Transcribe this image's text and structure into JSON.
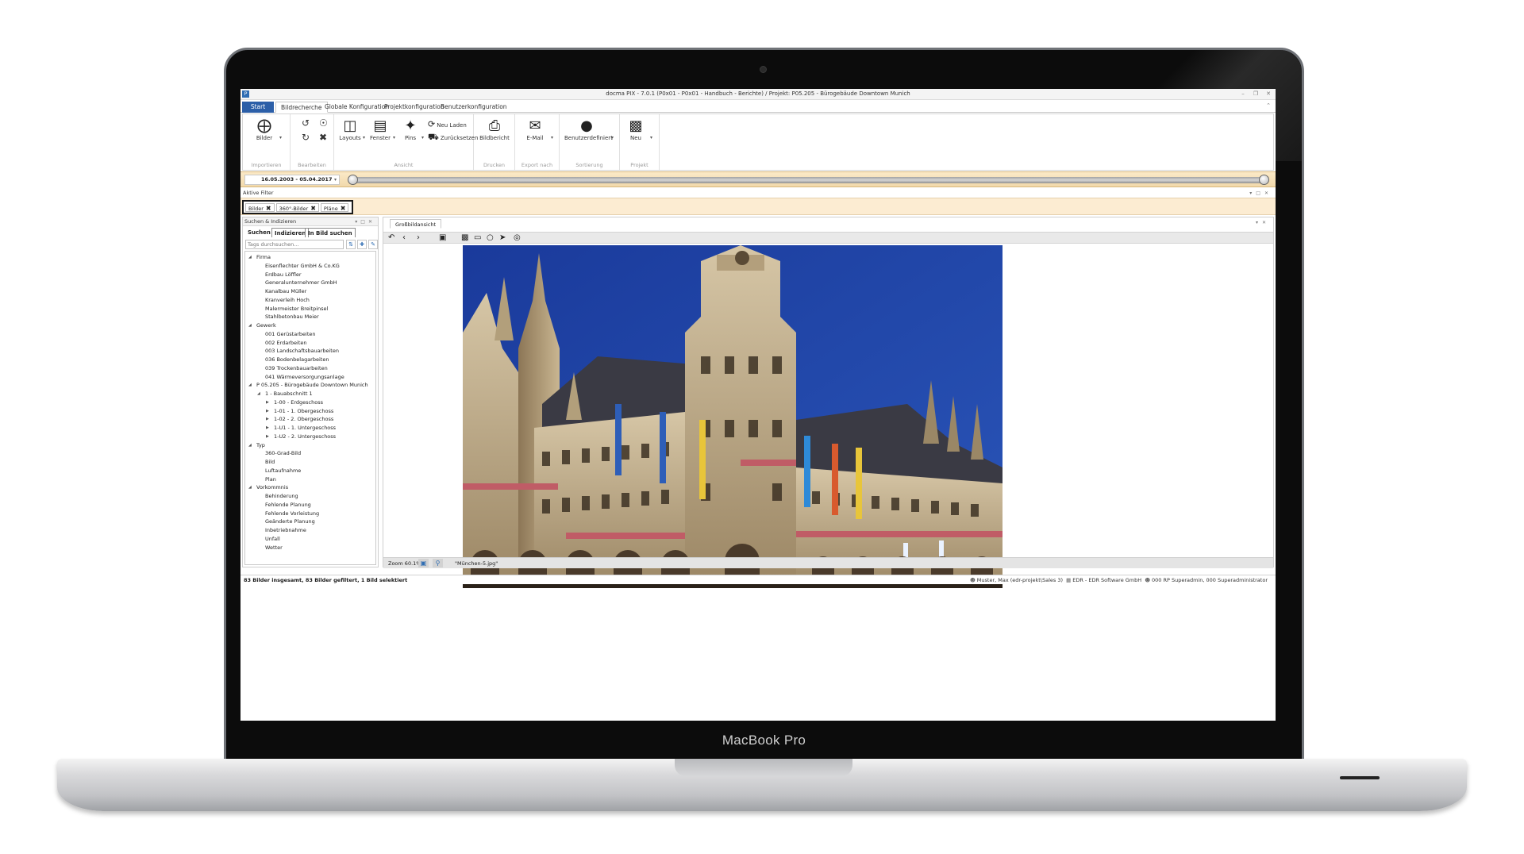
{
  "window": {
    "title": "docma PIX - 7.0.1 (P0x01 - P0x01 - Handbuch - Berichte) / Projekt: P05.205 - Bürogebäude Downtown Munich",
    "app_icon": "app-icon",
    "controls": [
      "minimize-icon",
      "restore-icon",
      "close-icon"
    ]
  },
  "tabs": [
    {
      "label": "Start"
    },
    {
      "label": "Bildrecherche"
    },
    {
      "label": "Globale Konfiguration"
    },
    {
      "label": "Projektkonfiguration"
    },
    {
      "label": "Benutzerkonfiguration"
    }
  ],
  "ribbon": {
    "groups": [
      {
        "label": "Importieren"
      },
      {
        "label": "Bearbeiten"
      },
      {
        "label": "Ansicht"
      },
      {
        "label": "Drucken"
      },
      {
        "label": "Export nach"
      },
      {
        "label": "Sortierung"
      },
      {
        "label": "Projekt"
      }
    ],
    "buttons": {
      "bilder": "Bilder",
      "layouts": "Layouts",
      "fenster": "Fenster",
      "pins": "Pins",
      "neu_laden": "Neu Laden",
      "zuruecksetzen": "Zurücksetzen",
      "bildbericht": "Bildbericht",
      "email": "E-Mail",
      "benutzerdefiniert": "Benutzerdefiniert",
      "neu": "Neu"
    }
  },
  "date_range": {
    "value": "16.05.2003 - 05.04.2017",
    "slider_start": 0.0,
    "slider_end": 1.0
  },
  "filters": {
    "header": "Aktive Filter",
    "chips": [
      "Bilder",
      "360°-Bilder",
      "Pläne"
    ]
  },
  "left_panel": {
    "title": "Suchen & Indizieren",
    "tabs": [
      "Suchen",
      "Indizieren",
      "In Bild suchen"
    ],
    "tag_placeholder": "Tags durchsuchen...",
    "tree": [
      {
        "label": "Firma",
        "level": 0,
        "expander": "expanded"
      },
      {
        "label": "Eisenflechter GmbH & Co.KG",
        "level": 1
      },
      {
        "label": "Erdbau Löffler",
        "level": 1
      },
      {
        "label": "Generalunternehmer GmbH",
        "level": 1
      },
      {
        "label": "Kanalbau Müller",
        "level": 1
      },
      {
        "label": "Kranverleih Hoch",
        "level": 1
      },
      {
        "label": "Malermeister Breitpinsel",
        "level": 1
      },
      {
        "label": "Stahlbetonbau Meier",
        "level": 1
      },
      {
        "label": "Gewerk",
        "level": 0,
        "expander": "expanded"
      },
      {
        "label": "001 Gerüstarbeiten",
        "level": 1
      },
      {
        "label": "002 Erdarbeiten",
        "level": 1
      },
      {
        "label": "003 Landschaftsbauarbeiten",
        "level": 1
      },
      {
        "label": "036 Bodenbelagarbeiten",
        "level": 1
      },
      {
        "label": "039 Trockenbauarbeiten",
        "level": 1
      },
      {
        "label": "041 Wärmeversorgungsanlage",
        "level": 1
      },
      {
        "label": "P 05.205 - Bürogebäude Downtown Munich",
        "level": 0,
        "expander": "expanded"
      },
      {
        "label": "1 - Bauabschnitt 1",
        "level": 1,
        "expander": "expanded"
      },
      {
        "label": "1-00 - Erdgeschoss",
        "level": 2,
        "expander": "collapsed"
      },
      {
        "label": "1-01 - 1. Obergeschoss",
        "level": 2,
        "expander": "collapsed"
      },
      {
        "label": "1-02 - 2. Obergeschoss",
        "level": 2,
        "expander": "collapsed"
      },
      {
        "label": "1-U1 - 1. Untergeschoss",
        "level": 2,
        "expander": "collapsed"
      },
      {
        "label": "1-U2 - 2. Untergeschoss",
        "level": 2,
        "expander": "collapsed"
      },
      {
        "label": "Typ",
        "level": 0,
        "expander": "expanded"
      },
      {
        "label": "360-Grad-Bild",
        "level": 1
      },
      {
        "label": "Bild",
        "level": 1
      },
      {
        "label": "Luftaufnahme",
        "level": 1
      },
      {
        "label": "Plan",
        "level": 1
      },
      {
        "label": "Vorkommnis",
        "level": 0,
        "expander": "expanded"
      },
      {
        "label": "Behinderung",
        "level": 1
      },
      {
        "label": "Fehlende Planung",
        "level": 1
      },
      {
        "label": "Fehlende Vorleistung",
        "level": 1
      },
      {
        "label": "Geänderte Planung",
        "level": 1
      },
      {
        "label": "Inbetriebnahme",
        "level": 1
      },
      {
        "label": "Unfall",
        "level": 1
      },
      {
        "label": "Wetter",
        "level": 1
      }
    ]
  },
  "main_panel": {
    "tab": "Großbildansicht",
    "toolbar_icons": [
      "undo-icon",
      "back-icon",
      "forward-icon",
      "lock-icon",
      "save-icon",
      "rectangle-icon",
      "circle-icon",
      "arrow-icon",
      "target-icon"
    ],
    "zoom": "Zoom 60.1%",
    "filename": "\"München-5.jpg\""
  },
  "status": {
    "left": "83 Bilder insgesamt, 83 Bilder gefiltert, 1 Bild selektiert",
    "user": "Muster, Max (edr-projekt\\Sales 3)",
    "company": "EDR - EDR Software GmbH",
    "role": "000 RP Superadmin, 000 Superadministrator"
  },
  "device": {
    "brand": "MacBook Pro"
  },
  "colors": {
    "start_tab": "#2c5fa8",
    "timeline": "#f1d9ab",
    "filterbar": "#fcecd2",
    "sky": "#1d3d96"
  }
}
